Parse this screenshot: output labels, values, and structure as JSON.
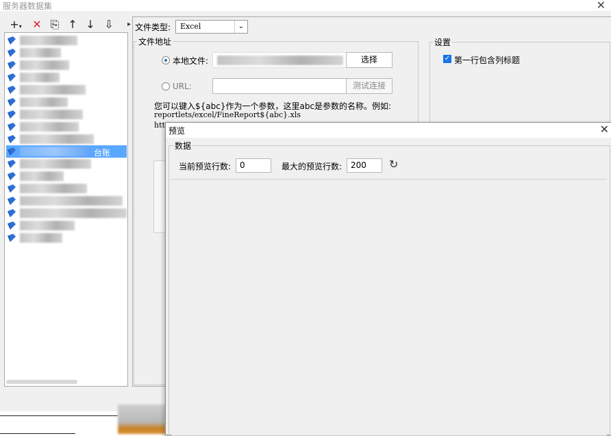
{
  "window": {
    "title": "服务器数据集"
  },
  "toolbar": {
    "add": "+",
    "delete": "✕",
    "copy": "⎘",
    "move_up": "↑",
    "move_down": "↓",
    "sort": "⇩"
  },
  "tree": {
    "selected_label": "台账"
  },
  "form": {
    "file_type_label": "文件类型:",
    "file_type_value": "Excel",
    "file_address_title": "文件地址",
    "local_file_label": "本地文件:",
    "choose_button": "选择",
    "url_label": "URL:",
    "test_connection_button": "测试连接",
    "hint_line1": "您可以键入${abc}作为一个参数，这里abc是参数的名称。例如:",
    "hint_line2": "reportlets/excel/FineReport${abc}.xls",
    "hint_line3": "htt"
  },
  "settings": {
    "title": "设置",
    "first_row_header_label": "第一行包含列标题"
  },
  "preview_dialog": {
    "title": "预览",
    "data_group_title": "数据",
    "current_rows_label": "当前预览行数:",
    "current_rows_value": "0",
    "max_rows_label": "最大的预览行数:",
    "max_rows_value": "200",
    "refresh_icon": "↻"
  }
}
